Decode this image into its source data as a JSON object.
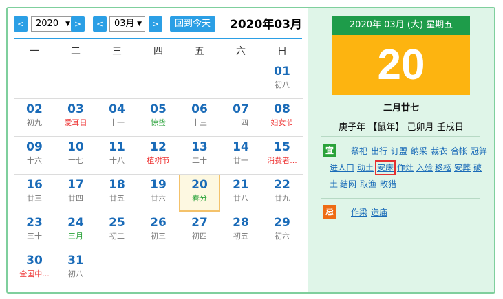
{
  "toolbar": {
    "prev_year": "<",
    "year_value": "2020",
    "next_year": ">",
    "prev_month": "<",
    "month_value": "03月",
    "next_month": ">",
    "today_label": "回到今天",
    "month_title": "2020年03月"
  },
  "weekdays": [
    "一",
    "二",
    "三",
    "四",
    "五",
    "六",
    "日"
  ],
  "weeks": [
    [
      null,
      null,
      null,
      null,
      null,
      null,
      {
        "day": "01",
        "lunar": "初八",
        "style": "normal"
      }
    ],
    [
      {
        "day": "02",
        "lunar": "初九",
        "style": "normal"
      },
      {
        "day": "03",
        "lunar": "爱耳日",
        "style": "red"
      },
      {
        "day": "04",
        "lunar": "十一",
        "style": "normal"
      },
      {
        "day": "05",
        "lunar": "惊蛰",
        "style": "green"
      },
      {
        "day": "06",
        "lunar": "十三",
        "style": "normal"
      },
      {
        "day": "07",
        "lunar": "十四",
        "style": "normal"
      },
      {
        "day": "08",
        "lunar": "妇女节",
        "style": "red"
      }
    ],
    [
      {
        "day": "09",
        "lunar": "十六",
        "style": "normal"
      },
      {
        "day": "10",
        "lunar": "十七",
        "style": "normal"
      },
      {
        "day": "11",
        "lunar": "十八",
        "style": "normal"
      },
      {
        "day": "12",
        "lunar": "植树节",
        "style": "red"
      },
      {
        "day": "13",
        "lunar": "二十",
        "style": "normal"
      },
      {
        "day": "14",
        "lunar": "廿一",
        "style": "normal"
      },
      {
        "day": "15",
        "lunar": "消费者...",
        "style": "red"
      }
    ],
    [
      {
        "day": "16",
        "lunar": "廿三",
        "style": "normal"
      },
      {
        "day": "17",
        "lunar": "廿四",
        "style": "normal"
      },
      {
        "day": "18",
        "lunar": "廿五",
        "style": "normal"
      },
      {
        "day": "19",
        "lunar": "廿六",
        "style": "normal"
      },
      {
        "day": "20",
        "lunar": "春分",
        "style": "green",
        "today": true
      },
      {
        "day": "21",
        "lunar": "廿八",
        "style": "normal"
      },
      {
        "day": "22",
        "lunar": "廿九",
        "style": "normal"
      }
    ],
    [
      {
        "day": "23",
        "lunar": "三十",
        "style": "normal"
      },
      {
        "day": "24",
        "lunar": "三月",
        "style": "green"
      },
      {
        "day": "25",
        "lunar": "初二",
        "style": "normal"
      },
      {
        "day": "26",
        "lunar": "初三",
        "style": "normal"
      },
      {
        "day": "27",
        "lunar": "初四",
        "style": "normal"
      },
      {
        "day": "28",
        "lunar": "初五",
        "style": "normal"
      },
      {
        "day": "29",
        "lunar": "初六",
        "style": "normal"
      }
    ],
    [
      {
        "day": "30",
        "lunar": "全国中...",
        "style": "red"
      },
      {
        "day": "31",
        "lunar": "初八",
        "style": "normal"
      },
      null,
      null,
      null,
      null,
      null
    ]
  ],
  "detail": {
    "header": "2020年 03月 (大) 星期五",
    "big_day": "20",
    "lunar_date": "二月廿七",
    "ganzhi": "庚子年 【鼠年】 己卯月 壬戌日",
    "yi_label": "宜",
    "yi_lines": [
      [
        "祭祀",
        "出行",
        "订盟",
        "纳采",
        "裁衣",
        "合帐",
        "冠笄"
      ],
      [
        "进人口",
        "动土",
        "安床",
        "作灶",
        "入殓",
        "移柩",
        "安葬",
        "破"
      ],
      [
        "土",
        "结网",
        "取渔",
        "畋猎"
      ]
    ],
    "highlighted": "安床",
    "ji_label": "忌",
    "ji_items": [
      "作梁",
      "造庙"
    ]
  },
  "colors": {
    "accent_blue": "#2b9fe5",
    "day_blue": "#1a6bb8",
    "festival_red": "#e33333",
    "solar_term_green": "#2aa23a",
    "header_green": "#1e9c4a",
    "big_day_orange": "#fdb410",
    "panel_bg": "#dff5e8"
  }
}
